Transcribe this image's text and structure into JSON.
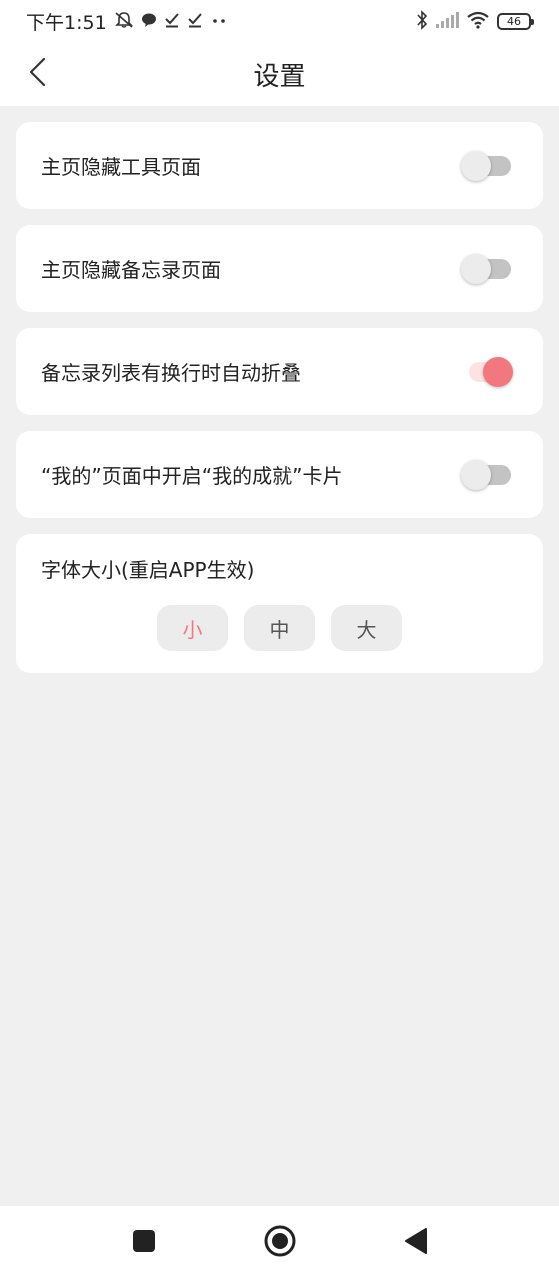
{
  "status_bar": {
    "time": "下午1:51",
    "left_icons": [
      "mute-bell-icon",
      "chat-bubble-icon",
      "check-icon",
      "check-icon",
      "more-dots-icon"
    ],
    "right_icons": [
      "bluetooth-icon",
      "signal-icon",
      "wifi-icon"
    ],
    "battery": "46"
  },
  "header": {
    "title": "设置",
    "back_icon": "chevron-left-icon"
  },
  "settings": [
    {
      "label": "主页隐藏工具页面",
      "enabled": false
    },
    {
      "label": "主页隐藏备忘录页面",
      "enabled": false
    },
    {
      "label": "备忘录列表有换行时自动折叠",
      "enabled": true
    },
    {
      "label": "“我的”页面中开启“我的成就”卡片",
      "enabled": false
    }
  ],
  "font_size": {
    "title": "字体大小(重启APP生效)",
    "options": [
      "小",
      "中",
      "大"
    ],
    "selected": "小"
  },
  "nav_bar": {
    "buttons": [
      "recents-square-icon",
      "home-circle-icon",
      "back-triangle-icon"
    ]
  },
  "colors": {
    "accent": "#f2787f",
    "accent_track": "#fde2e3",
    "background": "#f0f0f0",
    "card": "#ffffff"
  }
}
